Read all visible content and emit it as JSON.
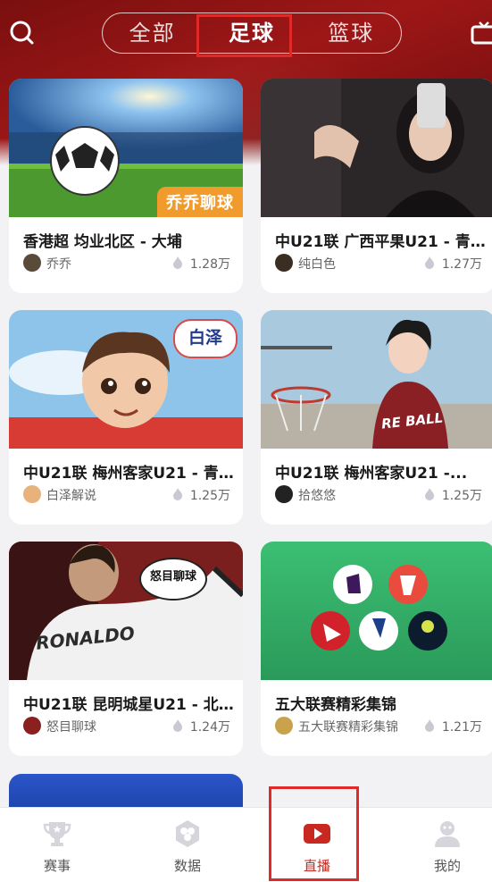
{
  "header": {
    "tabs": [
      {
        "label": "全部",
        "active": false
      },
      {
        "label": "足球",
        "active": true
      },
      {
        "label": "篮球",
        "active": false
      }
    ],
    "left_icon": "search-icon",
    "right_icon": "tv-icon"
  },
  "cards": [
    {
      "title": "香港超  均业北区 - 大埔",
      "author": "乔乔",
      "count": "1.28万",
      "badge": "乔乔聊球"
    },
    {
      "title": "中U21联 广西平果U21 - 青...",
      "author": "纯白色",
      "count": "1.27万"
    },
    {
      "title": "中U21联  梅州客家U21 - 青...",
      "author": "白泽解说",
      "count": "1.25万",
      "badge": "白泽"
    },
    {
      "title": "中U21联   梅州客家U21 -...",
      "author": "拾悠悠",
      "count": "1.25万",
      "jersey": "RE BALL"
    },
    {
      "title": "中U21联  昆明城星U21 - 北...",
      "author": "怒目聊球",
      "count": "1.24万",
      "badge": "怒目聊球",
      "jersey": "RONALDO"
    },
    {
      "title": "五大联赛精彩集锦",
      "author": "五大联赛精彩集锦",
      "count": "1.21万"
    }
  ],
  "tabbar": {
    "items": [
      {
        "label": "赛事",
        "icon": "trophy-icon",
        "active": false
      },
      {
        "label": "数据",
        "icon": "data-icon",
        "active": false
      },
      {
        "label": "直播",
        "icon": "live-play-icon",
        "active": true
      },
      {
        "label": "我的",
        "icon": "user-icon",
        "active": false
      }
    ]
  },
  "colors": {
    "accent": "#c8281f",
    "header": "#9e1717",
    "badge": "#f09b2c"
  }
}
